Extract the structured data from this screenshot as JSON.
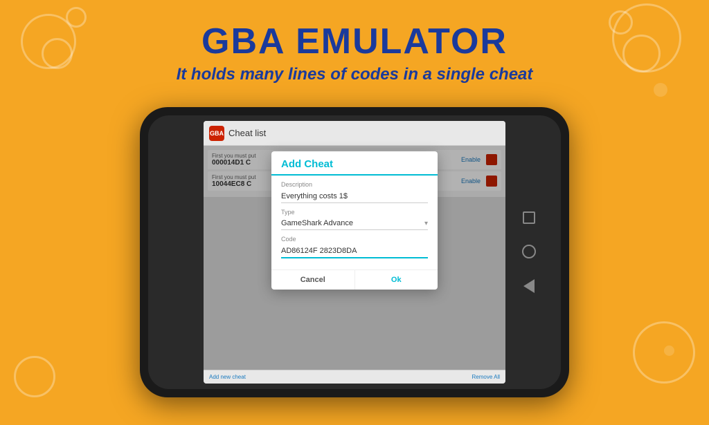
{
  "background": {
    "color": "#F5A623"
  },
  "header": {
    "title": "GBA EMULATOR",
    "subtitle": "It holds many lines of codes in a single cheat"
  },
  "phone": {
    "app_bar": {
      "icon_label": "GBA",
      "title": "Cheat list"
    },
    "cheat_items": [
      {
        "subtitle": "First you must put",
        "code": "000014D1 C",
        "enable_label": "Enable"
      },
      {
        "subtitle": "First you must put",
        "code": "10044EC8 C",
        "enable_label": "Enable"
      }
    ],
    "dialog": {
      "title": "Add Cheat",
      "description_label": "Description",
      "description_value": "Everything costs 1$",
      "type_label": "Type",
      "type_value": "GameShark Advance",
      "code_label": "Code",
      "code_value": "AD86124F 2823D8DA",
      "cancel_label": "Cancel",
      "ok_label": "Ok"
    },
    "bottom_bar": {
      "add_cheat": "Add new cheat",
      "remove_all": "Remove All"
    },
    "nav": {
      "square_label": "□",
      "circle_label": "○",
      "back_label": "◁"
    }
  }
}
